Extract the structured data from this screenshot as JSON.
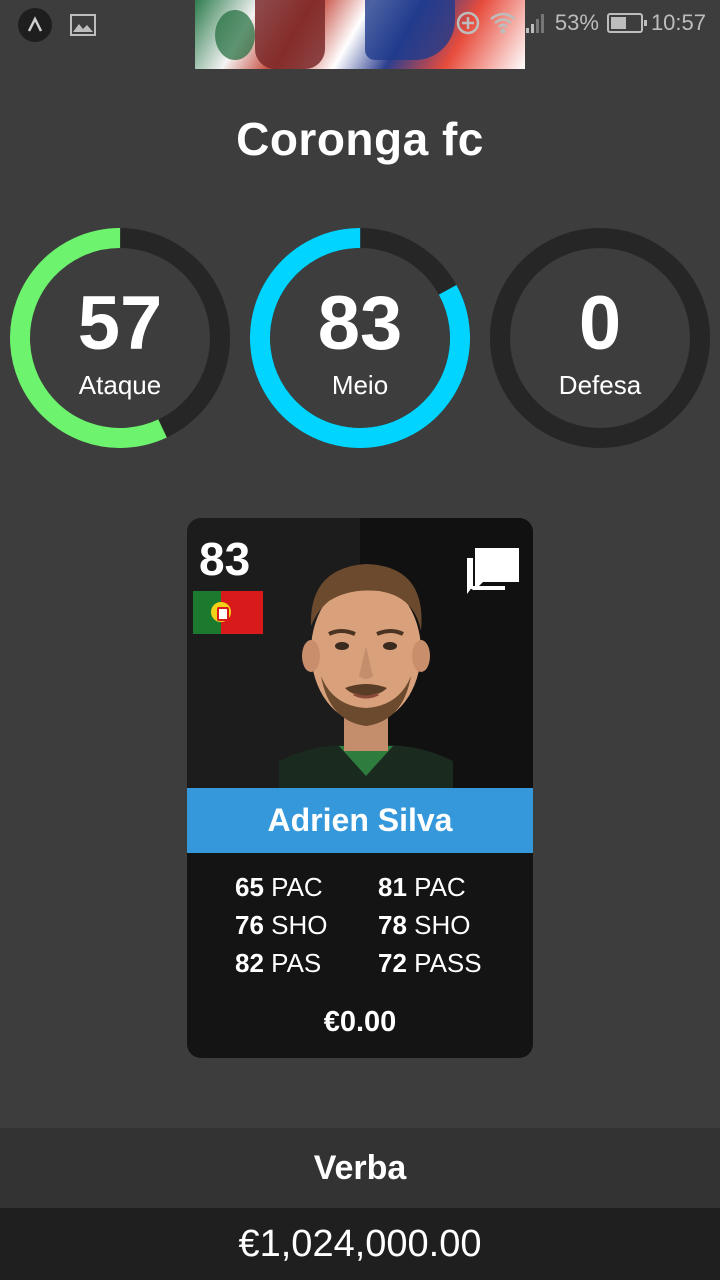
{
  "status_bar": {
    "battery": "53%",
    "time": "10:57",
    "battery_level": 0.53
  },
  "team": {
    "name": "Coronga fc"
  },
  "gauges": [
    {
      "value": "57",
      "label": "Ataque",
      "fraction": 0.57,
      "color": "#6ef36e"
    },
    {
      "value": "83",
      "label": "Meio",
      "fraction": 0.83,
      "color": "#00d4ff"
    },
    {
      "value": "0",
      "label": "Defesa",
      "fraction": 0.0,
      "color": "#6ef36e"
    }
  ],
  "gauge_track_color": "#262626",
  "player_card": {
    "rating": "83",
    "nationality_flag": "portugal-flag",
    "name": "Adrien Silva",
    "name_bar_color": "#3498db",
    "stats_left": [
      {
        "value": "65",
        "label": "PAC"
      },
      {
        "value": "76",
        "label": "SHO"
      },
      {
        "value": "82",
        "label": "PAS"
      }
    ],
    "stats_right": [
      {
        "value": "81",
        "label": "PAC"
      },
      {
        "value": "78",
        "label": "SHO"
      },
      {
        "value": "72",
        "label": "PASS"
      }
    ],
    "price": "€0.00"
  },
  "footer": {
    "budget_label": "Verba",
    "budget_value": "€1,024,000.00"
  }
}
